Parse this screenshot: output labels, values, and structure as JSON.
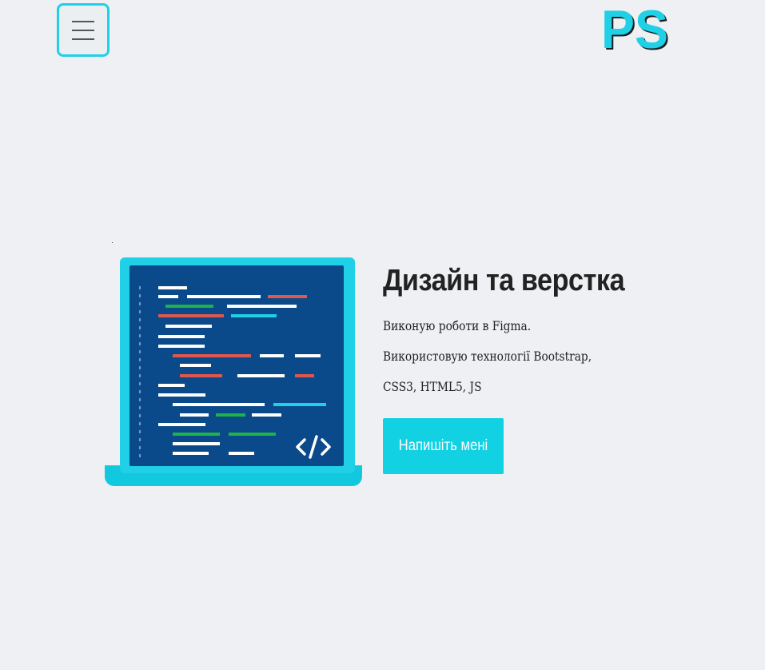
{
  "header": {
    "menu_icon": "hamburger-icon",
    "logo_text": "PS",
    "logo_color": "#1fd0e6"
  },
  "hero": {
    "title": "Дизайн та верстка",
    "lines": [
      "Виконую роботи в Figma.",
      "Використовую технології Bootstrap,",
      "CSS3, HTML5, JS"
    ],
    "button_label": "Напишіть мені",
    "accent_color": "#12d1e3",
    "illustration_icon": "laptop-code-icon"
  }
}
